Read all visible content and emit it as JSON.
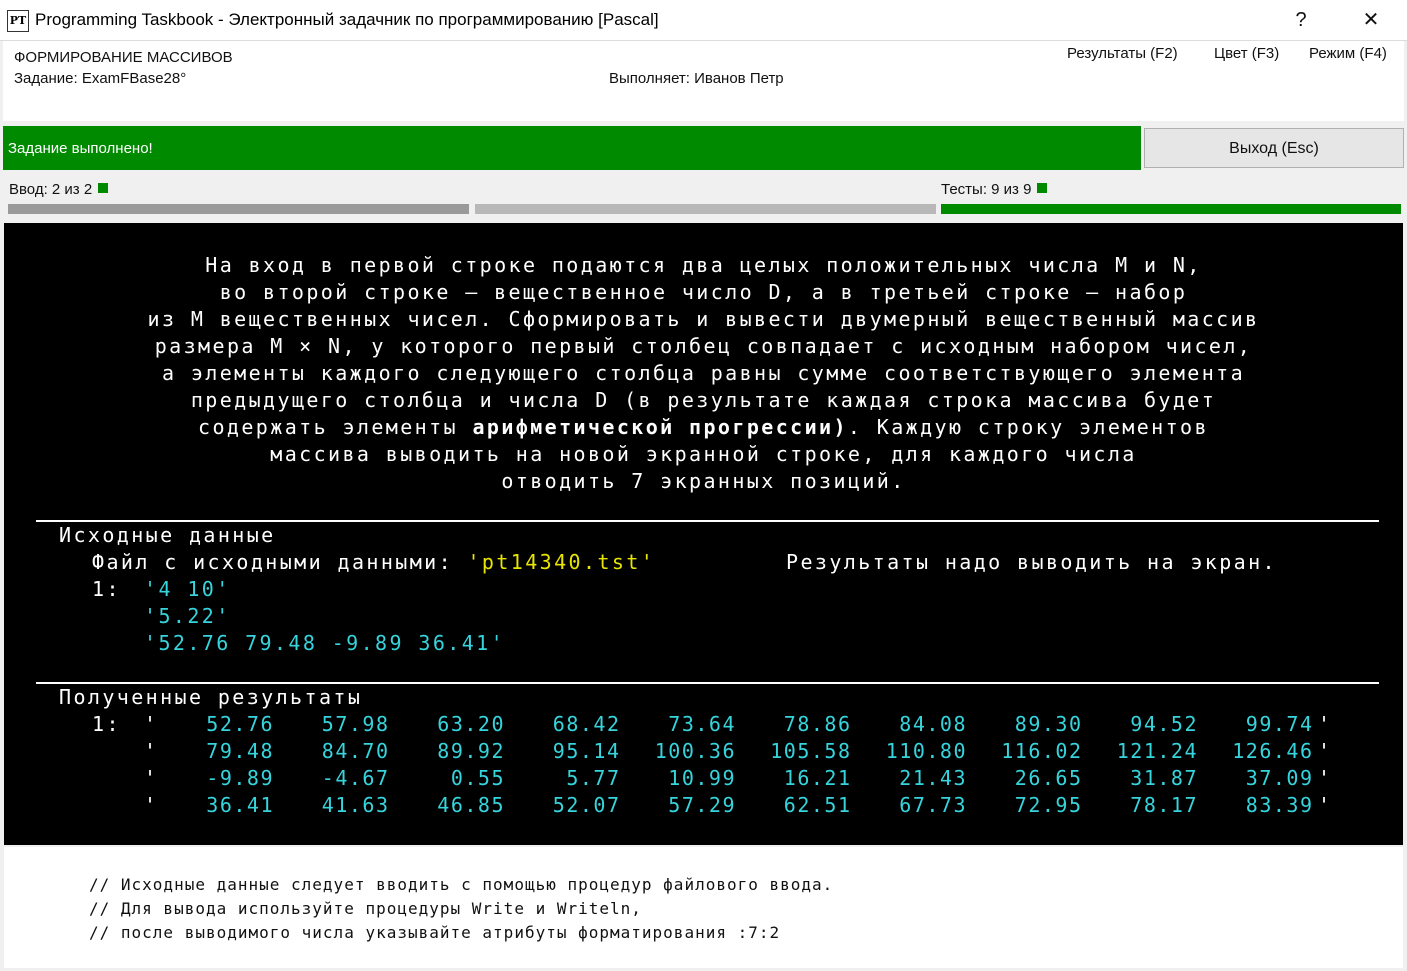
{
  "window": {
    "icon_text": "PT",
    "title": "Programming Taskbook - Электронный задачник по программированию [Pascal]",
    "help": "?",
    "close": "✕"
  },
  "header": {
    "group": "ФОРМИРОВАНИЕ МАССИВОВ",
    "task": "Задание: ExamFBase28°",
    "student": "Выполняет: Иванов Петр",
    "menu": [
      "Результаты (F2)",
      "Цвет (F3)",
      "Режим (F4)"
    ]
  },
  "status": {
    "message": "Задание выполнено!",
    "exit_label": "Выход (Esc)",
    "status_color": "#008a00"
  },
  "progress": {
    "input_label": "Ввод:  2 из 2",
    "input_fraction": 1.0,
    "tests_label": "Тесты:  9 из 9",
    "tests_fraction": 1.0
  },
  "task_text": {
    "lines": [
      "На вход в первой строке подаются два целых положительных числа M и N,",
      "во второй строке — вещественное число D, а в третьей строке — набор",
      "из M вещественных чисел. Сформировать и вывести двумерный вещественный массив",
      "размера M × N, у которого первый столбец совпадает с исходным набором чисел,",
      "а элементы каждого следующего столбца равны сумме соответствующего элемента",
      "предыдущего столбца и числа D (в результате каждая строка массива будет"
    ],
    "line7_before": "содержать элементы ",
    "line7_bold": "арифметической прогрессии)",
    "line7_after": ". Каждую строку элементов",
    "line8": "массива выводить на новой экранной строке, для каждого числа",
    "line9": "отводить 7 экранных позиций."
  },
  "input_section": {
    "heading": "Исходные данные",
    "file_label": "Файл с исходными данными: ",
    "file_name": "'pt14340.tst'",
    "output_note": "Результаты надо выводить на экран.",
    "index": "1:",
    "rows": [
      "'4 10'",
      "'5.22'",
      "'52.76 79.48 -9.89 36.41'"
    ]
  },
  "results_section": {
    "heading": "Полученные результаты",
    "index": "1:",
    "quote": "'",
    "rows": [
      [
        "52.76",
        "57.98",
        "63.20",
        "68.42",
        "73.64",
        "78.86",
        "84.08",
        "89.30",
        "94.52",
        "99.74"
      ],
      [
        "79.48",
        "84.70",
        "89.92",
        "95.14",
        "100.36",
        "105.58",
        "110.80",
        "116.02",
        "121.24",
        "126.46"
      ],
      [
        "-9.89",
        "-4.67",
        "0.55",
        "5.77",
        "10.99",
        "16.21",
        "21.43",
        "26.65",
        "31.87",
        "37.09"
      ],
      [
        "36.41",
        "41.63",
        "46.85",
        "52.07",
        "57.29",
        "62.51",
        "67.73",
        "72.95",
        "78.17",
        "83.39"
      ]
    ]
  },
  "comments": [
    "// Исходные данные следует вводить с помощью процедур файлового ввода.",
    "// Для вывода используйте процедуры Write и Writeln,",
    "// после выводимого числа указывайте атрибуты форматирования :7:2"
  ]
}
